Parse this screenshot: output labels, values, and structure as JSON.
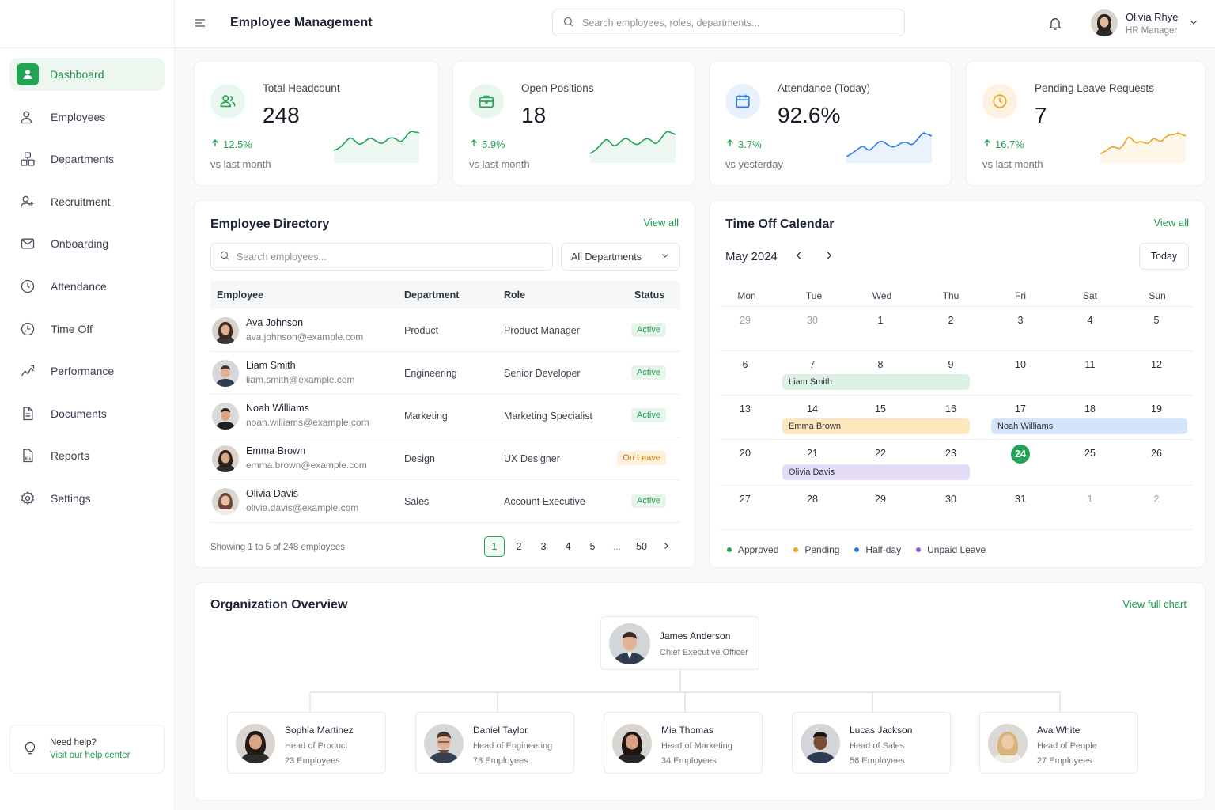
{
  "app": {
    "title": "Employee Management"
  },
  "search": {
    "placeholder": "Search employees, roles, departments..."
  },
  "user": {
    "name": "Olivia Rhye",
    "role": "HR Manager"
  },
  "sidebar": {
    "items": [
      {
        "label": "Dashboard",
        "icon": "user-icon"
      },
      {
        "label": "Employees",
        "icon": "users-icon"
      },
      {
        "label": "Departments",
        "icon": "departments-icon"
      },
      {
        "label": "Recruitment",
        "icon": "user-plus-icon"
      },
      {
        "label": "Onboarding",
        "icon": "mail-icon"
      },
      {
        "label": "Attendance",
        "icon": "clock-icon"
      },
      {
        "label": "Time Off",
        "icon": "time-off-icon"
      },
      {
        "label": "Performance",
        "icon": "trend-icon"
      },
      {
        "label": "Documents",
        "icon": "document-icon"
      },
      {
        "label": "Reports",
        "icon": "report-icon"
      },
      {
        "label": "Settings",
        "icon": "gear-icon"
      }
    ],
    "help": {
      "title": "Need help?",
      "link": "Visit our help center"
    }
  },
  "kpis": [
    {
      "label": "Total Headcount",
      "value": "248",
      "delta": "12.5%",
      "sub": "vs last month",
      "color": "#22a454",
      "bg": "#e8f6ed",
      "icon": "users-icon"
    },
    {
      "label": "Open Positions",
      "value": "18",
      "delta": "5.9%",
      "sub": "vs last month",
      "color": "#22a454",
      "bg": "#e8f6ed",
      "icon": "briefcase-icon"
    },
    {
      "label": "Attendance (Today)",
      "value": "92.6%",
      "delta": "3.7%",
      "sub": "vs yesterday",
      "color": "#2b7de9",
      "bg": "#e7f0fc",
      "icon": "calendar-icon"
    },
    {
      "label": "Pending Leave Requests",
      "value": "7",
      "delta": "16.7%",
      "sub": "vs last month",
      "color": "#f0a323",
      "bg": "#fdf2df",
      "icon": "clock-icon"
    }
  ],
  "directory": {
    "title": "Employee Directory",
    "view_all": "View all",
    "search_placeholder": "Search employees...",
    "filter": "All Departments",
    "columns": [
      "Employee",
      "Department",
      "Role",
      "Status"
    ],
    "rows": [
      {
        "name": "Ava Johnson",
        "email": "ava.johnson@example.com",
        "department": "Product",
        "role": "Product Manager",
        "status": "Active"
      },
      {
        "name": "Liam Smith",
        "email": "liam.smith@example.com",
        "department": "Engineering",
        "role": "Senior Developer",
        "status": "Active"
      },
      {
        "name": "Noah Williams",
        "email": "noah.williams@example.com",
        "department": "Marketing",
        "role": "Marketing Specialist",
        "status": "Active"
      },
      {
        "name": "Emma Brown",
        "email": "emma.brown@example.com",
        "department": "Design",
        "role": "UX Designer",
        "status": "On Leave"
      },
      {
        "name": "Olivia Davis",
        "email": "olivia.davis@example.com",
        "department": "Sales",
        "role": "Account Executive",
        "status": "Active"
      }
    ],
    "pager_info": "Showing 1 to 5 of 248 employees",
    "pages": [
      "1",
      "2",
      "3",
      "4",
      "5",
      "...",
      "50"
    ]
  },
  "calendar": {
    "title": "Time Off Calendar",
    "view_all": "View all",
    "month": "May 2024",
    "today_label": "Today",
    "weekdays": [
      "Mon",
      "Tue",
      "Wed",
      "Thu",
      "Fri",
      "Sat",
      "Sun"
    ],
    "weeks": [
      [
        "29",
        "30",
        "1",
        "2",
        "3",
        "4",
        "5"
      ],
      [
        "6",
        "7",
        "8",
        "9",
        "10",
        "11",
        "12"
      ],
      [
        "13",
        "14",
        "15",
        "16",
        "17",
        "18",
        "19"
      ],
      [
        "20",
        "21",
        "22",
        "23",
        "24",
        "25",
        "26"
      ],
      [
        "27",
        "28",
        "29",
        "30",
        "31",
        "1",
        "2"
      ]
    ],
    "events": [
      {
        "name": "Liam Smith",
        "type": "Approved"
      },
      {
        "name": "Emma Brown",
        "type": "Pending"
      },
      {
        "name": "Noah Williams",
        "type": "Half-day"
      },
      {
        "name": "Olivia Davis",
        "type": "Unpaid Leave"
      }
    ],
    "legend": [
      {
        "label": "Approved",
        "color": "#22a454"
      },
      {
        "label": "Pending",
        "color": "#f0a323"
      },
      {
        "label": "Half-day",
        "color": "#2b7de9"
      },
      {
        "label": "Unpaid Leave",
        "color": "#8e63d6"
      }
    ]
  },
  "org": {
    "title": "Organization Overview",
    "view_all": "View full chart",
    "ceo": {
      "name": "James Anderson",
      "role": "Chief Executive Officer"
    },
    "heads": [
      {
        "name": "Sophia Martinez",
        "role": "Head of Product",
        "count": "23 Employees"
      },
      {
        "name": "Daniel Taylor",
        "role": "Head of Engineering",
        "count": "78 Employees"
      },
      {
        "name": "Mia Thomas",
        "role": "Head of Marketing",
        "count": "34 Employees"
      },
      {
        "name": "Lucas Jackson",
        "role": "Head of Sales",
        "count": "56 Employees"
      },
      {
        "name": "Ava White",
        "role": "Head of People",
        "count": "27 Employees"
      }
    ]
  }
}
